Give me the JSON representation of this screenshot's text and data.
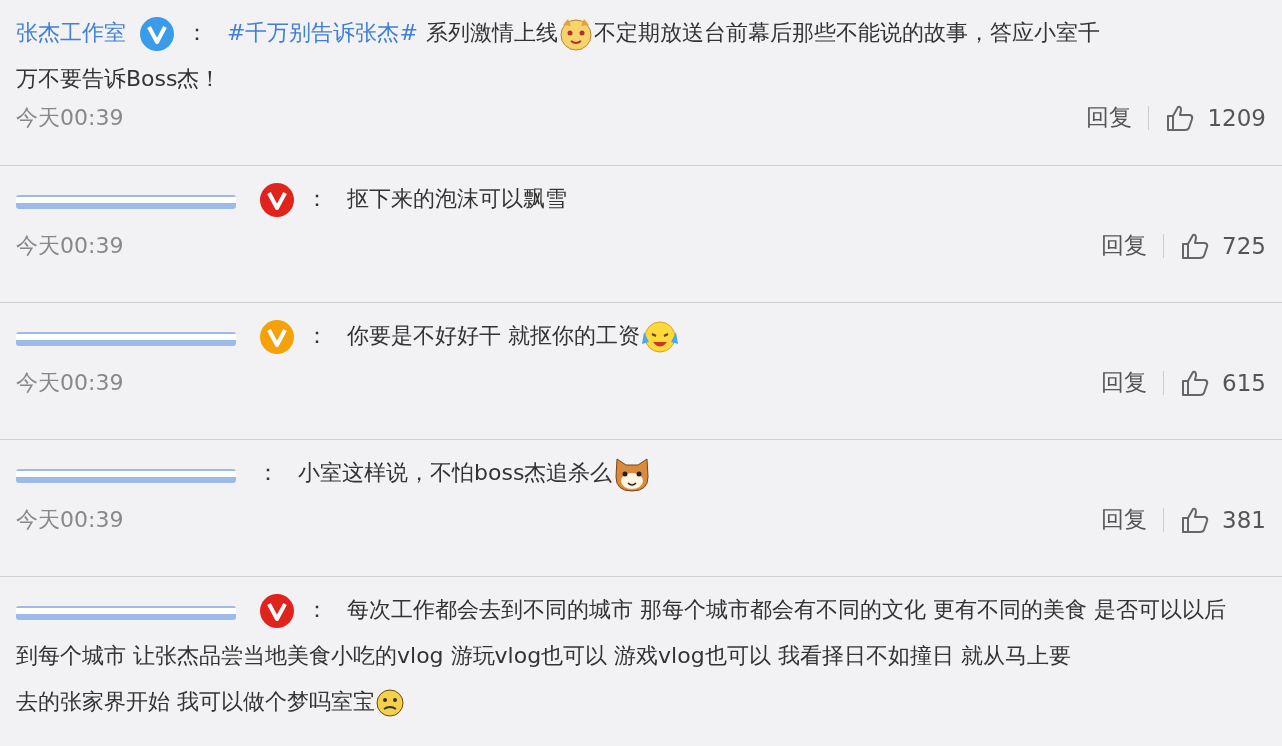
{
  "comments": [
    {
      "name": "张杰工作室",
      "name_redacted": false,
      "colon": "：",
      "badge": {
        "color": "#3a9be8"
      },
      "parts": [
        {
          "kind": "hashtag",
          "text": "#千万别告诉张杰#"
        },
        {
          "kind": "text",
          "text": "系列激情上线"
        },
        {
          "kind": "dog"
        },
        {
          "kind": "text",
          "text": "不定期放送台前幕后那些不能说的故事，答应小室千"
        },
        {
          "kind": "line",
          "text": "万不要告诉Boss杰！"
        }
      ],
      "time": "今天00:39",
      "reply": "回复",
      "likes": "1209"
    },
    {
      "name_redacted": true,
      "colon": "：",
      "badge": {
        "color": "#e0231c"
      },
      "parts": [
        {
          "kind": "text",
          "text": "抠下来的泡沫可以飘雪"
        }
      ],
      "time": "今天00:39",
      "reply": "回复",
      "likes": "725"
    },
    {
      "name_redacted": true,
      "colon": "：",
      "badge": {
        "color": "#f5a20a"
      },
      "parts": [
        {
          "kind": "text",
          "text": "你要是不好好干 就抠你的工资"
        },
        {
          "kind": "tears"
        }
      ],
      "time": "今天00:39",
      "reply": "回复",
      "likes": "615"
    },
    {
      "name_redacted": true,
      "colon": "：",
      "parts": [
        {
          "kind": "text",
          "text": "小室这样说，不怕boss杰追杀么"
        },
        {
          "kind": "cat"
        }
      ],
      "time": "今天00:39",
      "reply": "回复",
      "likes": "381"
    },
    {
      "name_redacted": true,
      "colon": "：",
      "badge": {
        "color": "#e0231c"
      },
      "parts": [
        {
          "kind": "text",
          "text": "每次工作都会去到不同的城市 那每个城市都会有不同的文化 更有不同的美食 是否可以以后"
        },
        {
          "kind": "line",
          "text": "到每个城市 让张杰品尝当地美食小吃的vlog 游玩vlog也可以 游戏vlog也可以 我看择日不如撞日 就从马上要"
        },
        {
          "kind": "line",
          "text": "去的张家界开始 我可以做个梦吗室宝"
        },
        {
          "kind": "frown"
        }
      ]
    }
  ]
}
